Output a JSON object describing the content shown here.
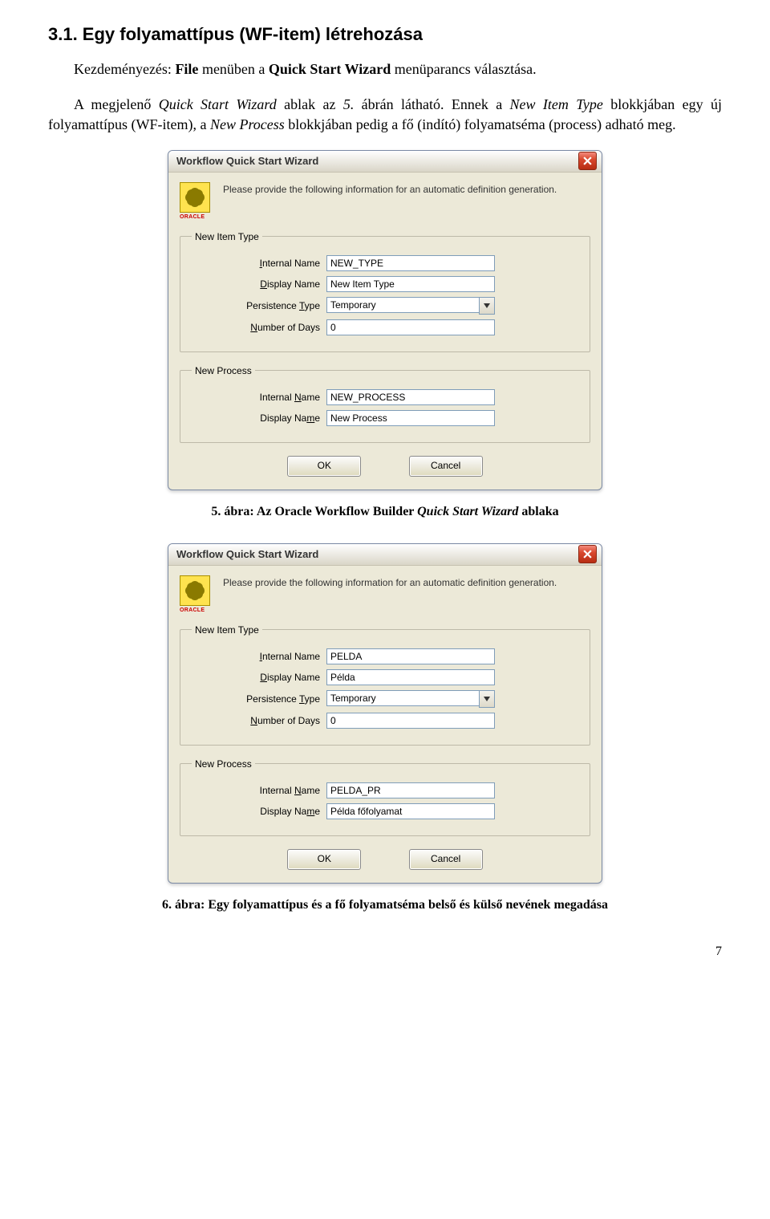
{
  "heading": "3.1. Egy folyamattípus (WF-item) létrehozása",
  "para1": {
    "prefix": "Kezdeményezés: ",
    "bold1": "File",
    "mid1": " menüben a ",
    "bold2": "Quick Start Wizard",
    "suffix": " menüparancs választása."
  },
  "para2": {
    "t1": "A megjelenő ",
    "it1": "Quick Start Wizard",
    "t2": " ablak az ",
    "it2": "5.",
    "t3": " ábrán látható. Ennek a ",
    "it3": "New Item Type",
    "t4": " blokkjában egy új folyamattípus (WF-item), a ",
    "it4": "New Process",
    "t5": " blokkjában pedig a fő (indító) folyamatséma (process) adható meg."
  },
  "dialogTitle": "Workflow Quick Start Wizard",
  "introText": "Please provide the following information for an automatic definition generation.",
  "legendItem": "New Item Type",
  "legendProcess": "New Process",
  "lbl": {
    "internal_I": "I",
    "internal": "nternal Name",
    "display_D": "D",
    "display": "isplay Name",
    "persist_T": "T",
    "persist_pre": "Persistence ",
    "persist_post": "ype",
    "days_N": "N",
    "days": "umber of Days",
    "internal2_N": "N",
    "internal2_pre": "Internal ",
    "internal2_post": "ame",
    "display2_m": "m",
    "display2_pre": "Display Na",
    "display2_post": "e"
  },
  "dlg1": {
    "item_internal": "NEW_TYPE",
    "item_display": "New Item Type",
    "persistence": "Temporary",
    "days": "0",
    "proc_internal": "NEW_PROCESS",
    "proc_display": "New Process"
  },
  "dlg2": {
    "item_internal": "PELDA",
    "item_display": "Példa",
    "persistence": "Temporary",
    "days": "0",
    "proc_internal": "PELDA_PR",
    "proc_display": "Példa főfolyamat"
  },
  "buttons": {
    "ok": "OK",
    "cancel": "Cancel"
  },
  "caption1": {
    "pre": "5. ábra: Az Oracle Workflow Builder ",
    "it": "Quick Start Wizard",
    "post": " ablaka"
  },
  "caption2": "6. ábra: Egy folyamattípus és a fő folyamatséma belső és külső nevének megadása",
  "pageNumber": "7"
}
